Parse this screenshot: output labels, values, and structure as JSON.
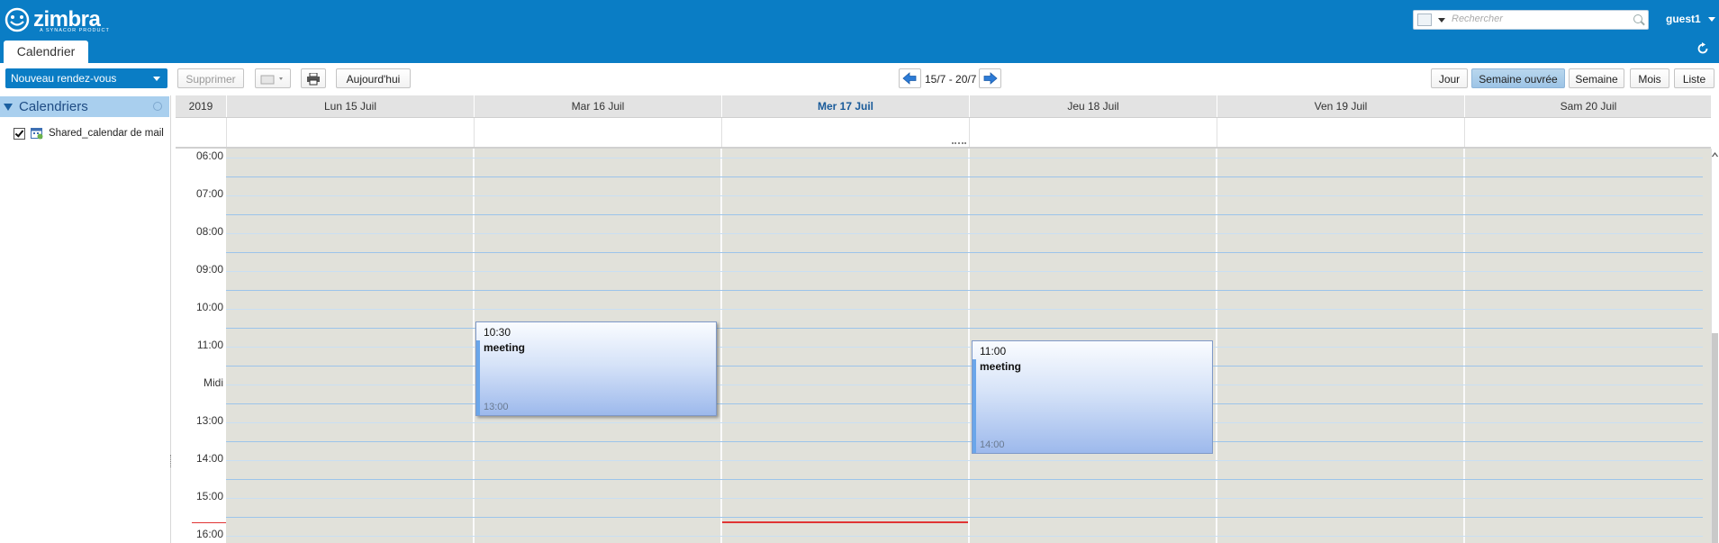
{
  "brand": {
    "name": "zimbra",
    "tagline": "A SYNACOR PRODUCT",
    "top_color": "#0a7dc5"
  },
  "search": {
    "placeholder": "Rechercher"
  },
  "user": {
    "name": "guest1"
  },
  "app_tab": {
    "label": "Calendrier"
  },
  "toolbar": {
    "new_appointment": "Nouveau rendez-vous",
    "delete": "Supprimer",
    "today": "Aujourd'hui",
    "date_range": "15/7 - 20/7",
    "views": [
      "Jour",
      "Semaine ouvrée",
      "Semaine",
      "Mois",
      "Liste"
    ],
    "active_view": "Semaine ouvrée"
  },
  "sidebar": {
    "header": "Calendriers",
    "calendars": [
      {
        "name": "Shared_calendar de mail",
        "checked": true
      }
    ]
  },
  "calendar": {
    "year": "2019",
    "days": [
      {
        "label": "Lun 15 Juil",
        "today": false
      },
      {
        "label": "Mar 16 Juil",
        "today": false
      },
      {
        "label": "Mer 17 Juil",
        "today": true
      },
      {
        "label": "Jeu 18 Juil",
        "today": false
      },
      {
        "label": "Ven 19 Juil",
        "today": false
      },
      {
        "label": "Sam 20 Juil",
        "today": false
      }
    ],
    "hours": [
      "06:00",
      "07:00",
      "08:00",
      "09:00",
      "10:00",
      "11:00",
      "Midi",
      "13:00",
      "14:00",
      "15:00",
      "16:00"
    ],
    "events": [
      {
        "title": "meeting",
        "start": "10:30",
        "end": "13:00",
        "day": "Mar 16 Juil"
      },
      {
        "title": "meeting",
        "start": "11:00",
        "end": "14:00",
        "day": "Jeu 18 Juil"
      }
    ],
    "now_time": "16:00",
    "colors": {
      "grid_bg": "#e1e1da",
      "hour_line": "#9cc4ea",
      "now_line": "#e03434",
      "today_header": "#1a5b9a"
    }
  }
}
